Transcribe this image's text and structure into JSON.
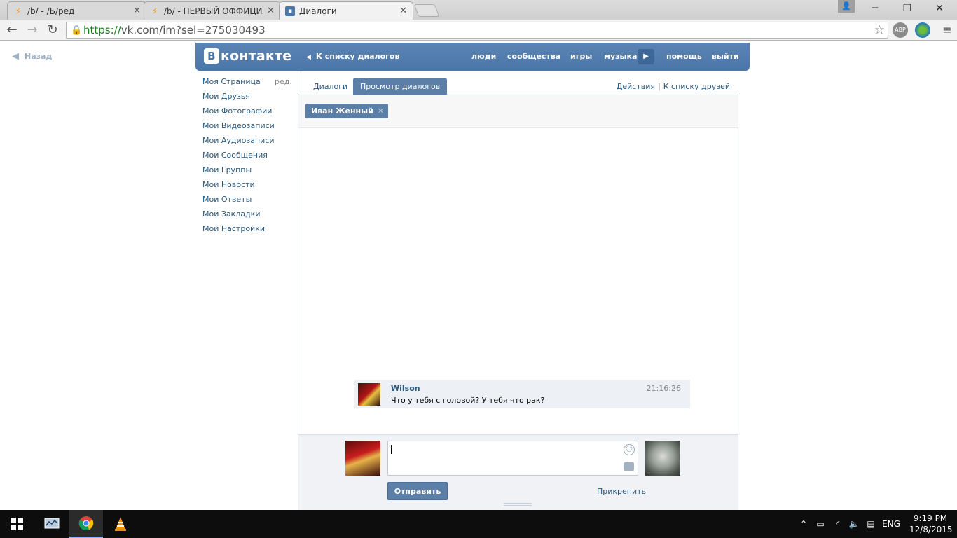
{
  "browser": {
    "tabs": [
      {
        "title": "/b/ - /Б/ред",
        "favicon": "bolt-icon"
      },
      {
        "title": "/b/ - ПЕРВЫЙ ОФФИЦИА",
        "favicon": "bolt-icon"
      },
      {
        "title": "Диалоги",
        "favicon": "vk-icon"
      }
    ],
    "url_secure": "https://",
    "url_rest": "vk.com/im?sel=275030493",
    "ext_abp": "ABP"
  },
  "page": {
    "back_link": "Назад"
  },
  "vk_header": {
    "logo_letter": "B",
    "logo_text": "контакте",
    "back_to_list": "К списку диалогов",
    "nav": [
      "люди",
      "сообщества",
      "игры",
      "музыка",
      "помощь",
      "выйти"
    ]
  },
  "side_menu": {
    "edit": "ред.",
    "items": [
      "Моя Страница",
      "Мои Друзья",
      "Мои Фотографии",
      "Мои Видеозаписи",
      "Мои Аудиозаписи",
      "Мои Сообщения",
      "Мои Группы",
      "Мои Новости",
      "Мои Ответы",
      "Мои Закладки",
      "Мои Настройки"
    ]
  },
  "dialog": {
    "tab_dialogs": "Диалоги",
    "tab_view": "Просмотр диалогов",
    "actions": "Действия",
    "friends_list": "К списку друзей",
    "peer_name": "Иван Женный",
    "message": {
      "author": "Wilson",
      "text": "Что у тебя с головой? У тебя что рак?",
      "time": "21:16:26"
    },
    "send_label": "Отправить",
    "attach_label": "Прикрепить"
  },
  "taskbar": {
    "language": "ENG",
    "time": "9:19 PM",
    "date": "12/8/2015"
  },
  "colors": {
    "vk_blue": "#4a76a8",
    "link": "#2b587a",
    "message_bg": "#edf1f5"
  }
}
